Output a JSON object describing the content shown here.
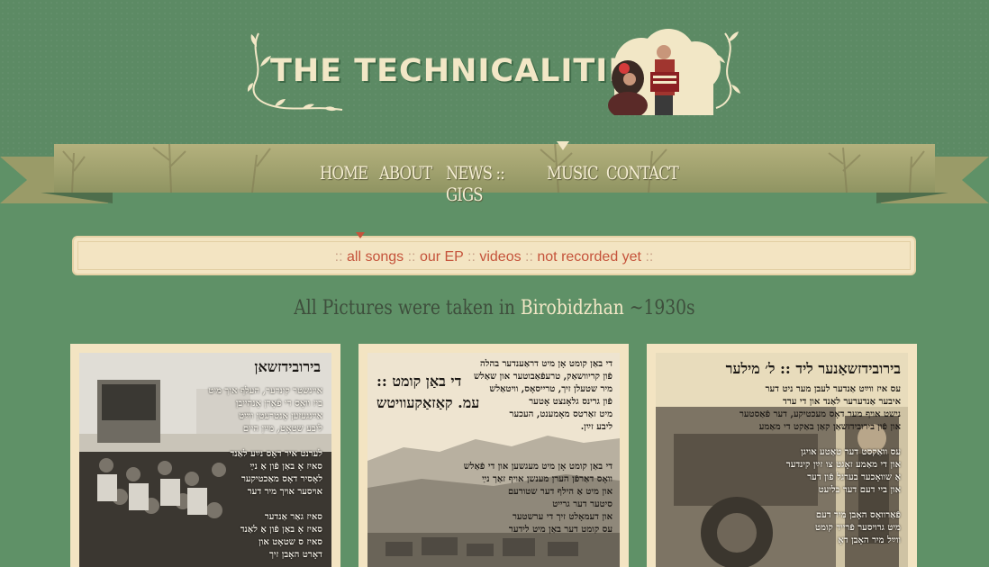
{
  "brand": {
    "title": "THE TECHNICALITIES",
    "photo_alt": "band-photo"
  },
  "nav": {
    "items": [
      {
        "label": "HOME"
      },
      {
        "label": "ABOUT"
      },
      {
        "label": "NEWS :: GIGS"
      },
      {
        "label": "MUSIC"
      },
      {
        "label": "CONTACT"
      }
    ]
  },
  "filters": {
    "sep_open": ":: ",
    "all_songs": "all songs",
    "sep1": "  :: ",
    "our_ep": "our EP",
    "sep2": " ::  ",
    "videos": "videos",
    "sep3": " ::  ",
    "not_recorded": "not recorded yet",
    "sep_close": " ::"
  },
  "caption": {
    "prefix": "All Pictures were taken in ",
    "place": "Birobidzhan",
    "suffix": " ~1930s"
  },
  "cards": [
    {
      "title": "בירובידזשאן",
      "lines": [
        "אײַנשטר קינדער, העלף איך מיט",
        "ביז וואָס די פֿאָרן אָנהייבן",
        "אײַנגעזען אָנטרעטן ווײַט",
        "ליבע שטאָט, מײַן היים",
        "",
        "לערנט איר דאָס נײַע לאַנד",
        "סאיז אָ באַן פֿון אַ נײַ",
        "לאָסיר דאָס מאַכטיקער",
        "אױסער אױך מיר דער",
        "",
        "סאיז גאַר אַנדער",
        "סאיז אָ באַן פֿון אַ לאַנד",
        "סאיז ס שטאָט און",
        "דאָרט האָבן זיך"
      ]
    },
    {
      "title": "די באַן קומט ::",
      "subtitle": "עמ. קאַזאַקעוויטש",
      "lines": [
        "די באַן קומט אָן מיט דראַענדער בהלה",
        "פֿון קריוושאַק, טרעפֿאַבוטער און שאַלש",
        "מיר שטעלן זיך, טרייסאָס, וויטאַלש",
        "פֿון גרינס גלאָנצט אָטער",
        "מיט זאַרטס מאָמענט, העכער",
        "ליבע זײַן.",
        "",
        "די באַן קומט אָן מיט מעגשען און די פֿאַלש",
        "וואָס דאַרפֿן הערן מענשן אויף זאַך נײַ",
        "און מיט אַ הילף דער שטורעם",
        "סיטער דער גרייט",
        "און דעמאָלט זיך די ערשטער",
        "עס קומט דער באַן מיט לידער"
      ]
    },
    {
      "title": "בירובידזשאַנער ליד :: ל׳ מילער",
      "lines": [
        "עס איז ווײַט אַנדער לעבן מער ניט דער",
        "איבער אַנדערער לאַנד און די ערד",
        "נישט אױף מער דאָס מעכטיקע, דער פֿאַסטער",
        "און פֿון בירובידזשאַן קאַן באַקט די מאַמע",
        "",
        "עס וואַקסט דער טאַטע אויגן",
        "און די מאַמע זאָגט צו זײַן קינדער",
        "אַ שוואָכער בערגל פֿון דער",
        "און ביי דעם דער בליעט",
        "",
        "פֿאַרוואָס האָבן מיר דעם",
        "מיט גרויסער פֿרייד קומט",
        "ווײַל מיר האָבן דאָ"
      ]
    }
  ],
  "colors": {
    "background": "#5f9167",
    "header": "#5c8a64",
    "cream": "#f3e4c2",
    "accent": "#c5533b"
  }
}
